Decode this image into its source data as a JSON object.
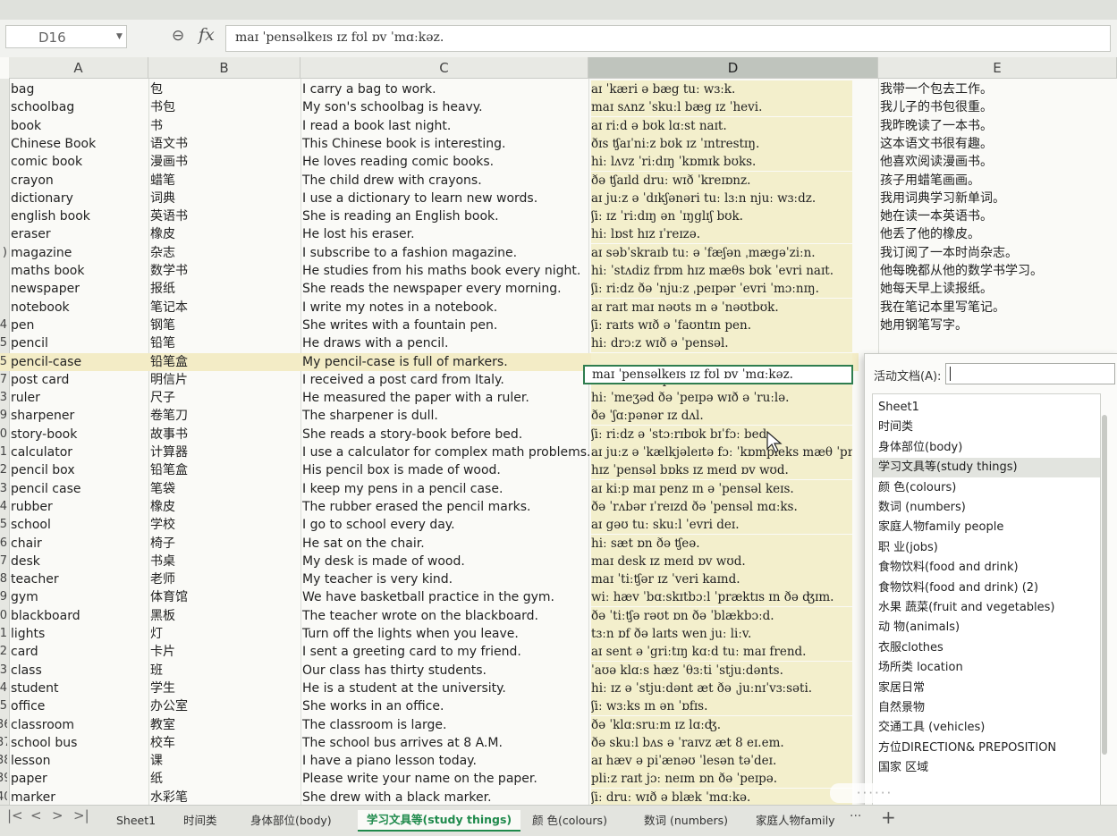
{
  "formula": {
    "name_box": "D16",
    "fx_label": "fx",
    "value": "maɪ ˈpensəlkeɪs ɪz fʊl ɒv ˈmɑːkəz."
  },
  "columns": [
    "A",
    "B",
    "C",
    "D",
    "E"
  ],
  "rows": [
    {
      "num": "",
      "a": "bag",
      "b": "包",
      "c": "I carry a bag to work.",
      "d": "aɪ ˈkæri ə bæg tuː wɜːk.",
      "e": "我带一个包去工作。"
    },
    {
      "num": "",
      "a": "schoolbag",
      "b": "书包",
      "c": "My son's schoolbag is heavy.",
      "d": "maɪ sʌnz ˈskuːl bæg ɪz ˈhevi.",
      "e": "我儿子的书包很重。"
    },
    {
      "num": "",
      "a": "book",
      "b": "书",
      "c": "I read a book last night.",
      "d": "aɪ riːd ə bʊk lɑːst naɪt.",
      "e": "我昨晚读了一本书。"
    },
    {
      "num": "",
      "a": "Chinese Book",
      "b": "语文书",
      "c": "This Chinese book is interesting.",
      "d": "ðɪs ʧaɪˈniːz bʊk ɪz ˈɪntrestɪŋ.",
      "e": "这本语文书很有趣。"
    },
    {
      "num": "",
      "a": "comic book",
      "b": "漫画书",
      "c": "He loves reading comic books.",
      "d": "hiː lʌvz ˈriːdɪŋ ˈkɒmɪk bʊks.",
      "e": "他喜欢阅读漫画书。"
    },
    {
      "num": "",
      "a": "crayon",
      "b": "蜡笔",
      "c": "The child drew with crayons.",
      "d": "ðə ʧaɪld druː wɪð ˈkreɪɒnz.",
      "e": "孩子用蜡笔画画。"
    },
    {
      "num": "",
      "a": "dictionary",
      "b": "词典",
      "c": "I use a dictionary to learn new words.",
      "d": "aɪ juːz ə ˈdɪkʃənəri tuː lɜːn njuː wɜːdz.",
      "e": "我用词典学习新单词。"
    },
    {
      "num": "",
      "a": "english book",
      "b": "英语书",
      "c": "She is reading an English book.",
      "d": "ʃiː ɪz ˈriːdɪŋ ən ˈɪŋglɪʃ bʊk.",
      "e": "她在读一本英语书。"
    },
    {
      "num": "",
      "a": "eraser",
      "b": "橡皮",
      "c": "He lost his eraser.",
      "d": "hiː lɒst hɪz ɪˈreɪzə.",
      "e": "他丢了他的橡皮。"
    },
    {
      "num": ")",
      "a": "magazine",
      "b": "杂志",
      "c": "I subscribe to a fashion magazine.",
      "d": "aɪ səbˈskraɪb tuː ə ˈfæʃən ˌmægəˈziːn.",
      "e": "我订阅了一本时尚杂志。"
    },
    {
      "num": "",
      "a": "maths book",
      "b": "数学书",
      "c": "He studies from his maths book every night.",
      "d": "hiː ˈstʌdiz frɒm hɪz mæθs bʊk ˈevri naɪt.",
      "e": "他每晚都从他的数学书学习。"
    },
    {
      "num": "",
      "a": "newspaper",
      "b": "报纸",
      "c": "She reads the newspaper every morning.",
      "d": "ʃiː riːdz ðə ˈnjuːz ˌpeɪpər ˈevri ˈmɔːnɪŋ.",
      "e": "她每天早上读报纸。"
    },
    {
      "num": "",
      "a": "notebook",
      "b": "笔记本",
      "c": "I write my notes in a notebook.",
      "d": "aɪ raɪt maɪ nəʊts ɪn ə ˈnəʊtbʊk.",
      "e": "我在笔记本里写笔记。"
    },
    {
      "num": "4",
      "a": "pen",
      "b": "钢笔",
      "c": "She writes with a fountain pen.",
      "d": "ʃiː raɪts wɪð ə ˈfaʊntɪn pen.",
      "e": "她用钢笔写字。"
    },
    {
      "num": "5",
      "a": "pencil",
      "b": "铅笔",
      "c": "He draws with a pencil.",
      "d": "hiː drɔːz wɪð ə ˈpensəl.",
      "e": ""
    },
    {
      "num": "5",
      "a": "pencil-case",
      "b": "铅笔盒",
      "c": "My pencil-case is full of markers.",
      "d": "",
      "e": ""
    },
    {
      "num": "7",
      "a": "post card",
      "b": "明信片",
      "c": "I received a post card from Italy.",
      "d": "aɪ rɪˈsiːvd ə pəʊst kɑːd frɒm ˈɪtəli.",
      "e": ""
    },
    {
      "num": "3",
      "a": "ruler",
      "b": "尺子",
      "c": "He measured the paper with a ruler.",
      "d": "hiː ˈmeʒəd ðə ˈpeɪpə wɪð ə ˈruːlə.",
      "e": ""
    },
    {
      "num": "9",
      "a": "sharpener",
      "b": "卷笔刀",
      "c": "The sharpener is dull.",
      "d": "ðə ˈʃɑːpənər ɪz dʌl.",
      "e": ""
    },
    {
      "num": "0",
      "a": "story-book",
      "b": "故事书",
      "c": "She reads a story-book before bed.",
      "d": "ʃiː riːdz ə ˈstɔːrɪbʊk bɪˈfɔː bed.",
      "e": ""
    },
    {
      "num": "1",
      "a": "calculator",
      "b": "计算器",
      "c": "I use a calculator for complex math problems.",
      "d": "aɪ juːz ə ˈkælkjəleɪtə fɔː ˈkɒmpleks mæθ ˈprɒbləmz.",
      "e": ""
    },
    {
      "num": "2",
      "a": "pencil box",
      "b": "铅笔盒",
      "c": "His pencil box is made of wood.",
      "d": "hɪz ˈpensəl bɒks ɪz meɪd ɒv wʊd.",
      "e": ""
    },
    {
      "num": "3",
      "a": "pencil case",
      "b": "笔袋",
      "c": "I keep my pens in a pencil case.",
      "d": "aɪ kiːp maɪ penz ɪn ə ˈpensəl keɪs.",
      "e": ""
    },
    {
      "num": "4",
      "a": "rubber",
      "b": "橡皮",
      "c": "The rubber erased the pencil marks.",
      "d": "ðə ˈrʌbər ɪˈreɪzd ðə ˈpensəl mɑːks.",
      "e": ""
    },
    {
      "num": "5",
      "a": "school",
      "b": "学校",
      "c": "I go to school every day.",
      "d": "aɪ gəʊ tuː skuːl ˈevri deɪ.",
      "e": ""
    },
    {
      "num": "6",
      "a": "chair",
      "b": "椅子",
      "c": "He sat on the chair.",
      "d": "hiː sæt ɒn ðə ʧeə.",
      "e": ""
    },
    {
      "num": "7",
      "a": "desk",
      "b": "书桌",
      "c": "My desk is made of wood.",
      "d": "maɪ desk ɪz meɪd ɒv wʊd.",
      "e": ""
    },
    {
      "num": "8",
      "a": "teacher",
      "b": "老师",
      "c": "My teacher is very kind.",
      "d": "maɪ ˈtiːʧər ɪz ˈveri kaɪnd.",
      "e": ""
    },
    {
      "num": "9",
      "a": "gym",
      "b": "体育馆",
      "c": "We have basketball practice in the gym.",
      "d": "wiː hæv ˈbɑːskɪtbɔːl ˈpræktɪs ɪn ðə ʤɪm.",
      "e": ""
    },
    {
      "num": "0",
      "a": "blackboard",
      "b": "黑板",
      "c": "The teacher wrote on the blackboard.",
      "d": "ðə ˈtiːʧə rəʊt ɒn ðə ˈblækbɔːd.",
      "e": ""
    },
    {
      "num": "1",
      "a": "lights",
      "b": "灯",
      "c": "Turn off the lights when you leave.",
      "d": "tɜːn ɒf ðə laɪts wen juː liːv.",
      "e": ""
    },
    {
      "num": "2",
      "a": "card",
      "b": "卡片",
      "c": "I sent a greeting card to my friend.",
      "d": "aɪ sent ə ˈgriːtɪŋ kɑːd tuː maɪ frend.",
      "e": ""
    },
    {
      "num": "3",
      "a": "class",
      "b": "班",
      "c": "Our class has thirty students.",
      "d": "ˈaʊə klɑːs hæz ˈθɜːti ˈstjuːdənts.",
      "e": ""
    },
    {
      "num": "4",
      "a": "student",
      "b": "学生",
      "c": "He is a student at the university.",
      "d": "hiː ɪz ə ˈstjuːdənt æt ðə ˌjuːnɪˈvɜːsəti.",
      "e": ""
    },
    {
      "num": "5",
      "a": "office",
      "b": "办公室",
      "c": "She works in an office.",
      "d": "ʃiː wɜːks ɪn ən ˈɒfɪs.",
      "e": ""
    },
    {
      "num": "36",
      "a": "classroom",
      "b": "教室",
      "c": "The classroom is large.",
      "d": "ðə ˈklɑːsruːm ɪz lɑːʤ.",
      "e": ""
    },
    {
      "num": "37",
      "a": "school bus",
      "b": "校车",
      "c": "The school bus arrives at 8 A.M.",
      "d": "ðə skuːl bʌs ə ˈraɪvz æt 8 eɪ.em.",
      "e": ""
    },
    {
      "num": "38",
      "a": "lesson",
      "b": "课",
      "c": "I have a piano lesson today.",
      "d": "aɪ hæv ə piˈænəʊ ˈlesən təˈdeɪ.",
      "e": ""
    },
    {
      "num": "39",
      "a": "paper",
      "b": "纸",
      "c": "Please write your name on the paper.",
      "d": "pliːz raɪt jɔː neɪm ɒn ðə ˈpeɪpə.",
      "e": ""
    },
    {
      "num": "40",
      "a": "marker",
      "b": "水彩笔",
      "c": "She drew with a black marker.",
      "d": "ʃiː druː wɪð ə blæk ˈmɑːkə.",
      "e": ""
    }
  ],
  "popup": {
    "label": "活动文档(A):",
    "items": [
      "Sheet1",
      "时间类",
      "身体部位(body)",
      "学习文具等(study things)",
      "颜  色(colours)",
      "数词 (numbers)",
      "家庭人物family people",
      "职  业(jobs)",
      "食物饮料(food and drink)",
      "食物饮料(food and drink) (2)",
      "水果 蔬菜(fruit and vegetables)",
      "动  物(animals)",
      "衣服clothes",
      "场所类 location",
      "家居日常",
      "自然景物",
      "交通工具 (vehicles)",
      "方位DIRECTION& PREPOSITION",
      "国家 区域"
    ],
    "selected_index": 3
  },
  "tabs": {
    "nav": [
      "|<",
      "<",
      ">",
      ">|"
    ],
    "items": [
      "Sheet1",
      "时间类",
      "身体部位(body)",
      "学习文具等(study things)",
      "颜  色(colours)",
      "数词 (numbers)",
      "家庭人物family"
    ],
    "active_index": 3,
    "more": "···",
    "add": "+"
  },
  "watermark": "······",
  "colors": {
    "active_tab": "#1f8a4c",
    "selection_border": "#2e7d4f",
    "column_d_fill": "#f3efcc",
    "selected_row": "#f3ecc6"
  },
  "icons": [
    "zoom-icon",
    "fx-icon",
    "dropdown-caret-icon",
    "mouse-cursor-icon"
  ]
}
